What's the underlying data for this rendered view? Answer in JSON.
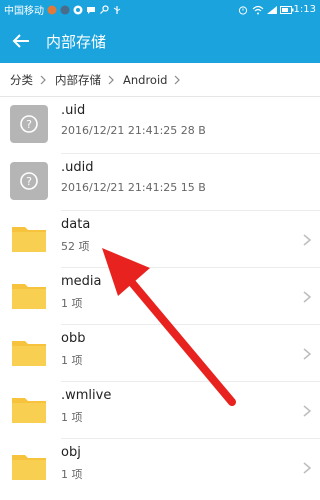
{
  "status": {
    "carrier": "中国移动",
    "time": "1:13"
  },
  "appbar": {
    "title": "内部存储"
  },
  "breadcrumb": [
    "分类",
    "内部存储",
    "Android"
  ],
  "files": [
    {
      "name": ".uid",
      "meta": "2016/12/21 21:41:25 28 B",
      "kind": "file"
    },
    {
      "name": ".udid",
      "meta": "2016/12/21 21:41:25 15 B",
      "kind": "file"
    },
    {
      "name": "data",
      "meta": "52 项",
      "kind": "folder"
    },
    {
      "name": "media",
      "meta": "1 项",
      "kind": "folder"
    },
    {
      "name": "obb",
      "meta": "1 项",
      "kind": "folder"
    },
    {
      "name": ".wmlive",
      "meta": "1 项",
      "kind": "folder"
    },
    {
      "name": "obj",
      "meta": "1 项",
      "kind": "folder"
    }
  ],
  "colors": {
    "accent": "#1aa3dd",
    "folder": "#f7c33d",
    "annotation_arrow": "#e8231f"
  }
}
